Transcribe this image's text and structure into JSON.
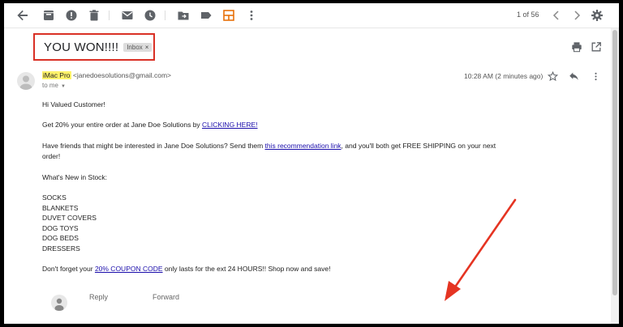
{
  "toolbar": {
    "icons": [
      "back-arrow-icon",
      "archive-icon",
      "report-spam-icon",
      "delete-icon",
      "mark-unread-icon",
      "snooze-icon",
      "move-to-icon",
      "label-icon",
      "layout-icon",
      "more-vert-icon"
    ],
    "pager": "1 of 56",
    "accent": "#e8710a"
  },
  "subject": {
    "title": "YOU WON!!!!",
    "badge": "Inbox",
    "badge_close": "×",
    "highlight_color": "#d93025"
  },
  "sender": {
    "name": "iMac Pro",
    "email": "<janedoesolutions@gmail.com>",
    "to": "to me",
    "time": "10:28 AM (2 minutes ago)",
    "name_highlight": "#fff36b"
  },
  "body": {
    "greeting": "Hi Valued Customer!",
    "line1_pre": "Get 20% your entire order at Jane Doe Solutions by ",
    "line1_link": "CLICKING HERE!",
    "line2_pre": "Have friends that might be interested in Jane Doe Solutions? Send them ",
    "line2_link": "this recommendation link",
    "line2_post": ", and you'll both get FREE SHIPPING on your next",
    "line2_cont": "order!",
    "whats_new": "What's New in Stock:",
    "items": [
      "SOCKS",
      "BLANKETS",
      "DUVET COVERS",
      "DOG TOYS",
      "DOG BEDS",
      "DRESSERS"
    ],
    "line3_pre": "Don't forget your ",
    "line3_link": "20% COUPON CODE",
    "line3_post": " only lasts for the ext 24 HOURS!! Shop now and save!"
  },
  "actions": {
    "reply": "Reply",
    "forward": "Forward"
  },
  "annotation": {
    "arrow_color": "#e53422"
  }
}
